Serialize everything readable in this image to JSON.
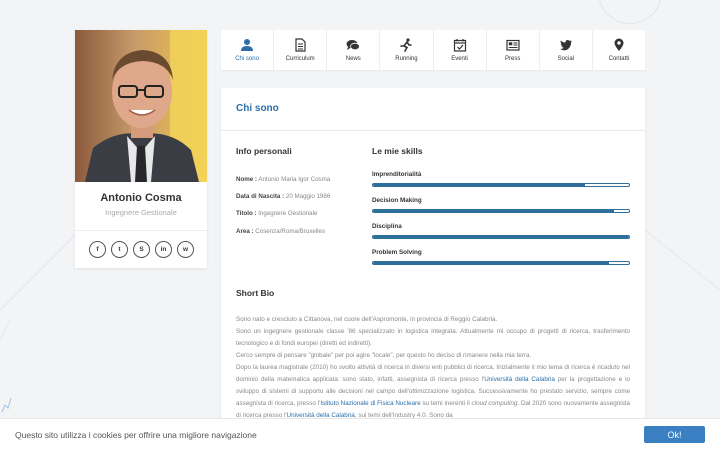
{
  "profile": {
    "name": "Antonio Cosma",
    "role": "Ingegnere Gestionale",
    "socials": [
      {
        "icon": "facebook-icon",
        "glyph": "f"
      },
      {
        "icon": "twitter-icon",
        "glyph": "t"
      },
      {
        "icon": "skype-icon",
        "glyph": "S"
      },
      {
        "icon": "linkedin-icon",
        "glyph": "in"
      },
      {
        "icon": "whatsapp-icon",
        "glyph": "w"
      }
    ]
  },
  "nav": {
    "items": [
      {
        "label": "Chi sono",
        "icon": "user-icon",
        "active": true
      },
      {
        "label": "Curriculum",
        "icon": "document-icon",
        "active": false
      },
      {
        "label": "News",
        "icon": "comments-icon",
        "active": false
      },
      {
        "label": "Running",
        "icon": "running-icon",
        "active": false
      },
      {
        "label": "Eventi",
        "icon": "calendar-icon",
        "active": false
      },
      {
        "label": "Press",
        "icon": "newspaper-icon",
        "active": false
      },
      {
        "label": "Social",
        "icon": "twitter-icon",
        "active": false
      },
      {
        "label": "Contatti",
        "icon": "map-marker-icon",
        "active": false
      }
    ]
  },
  "main": {
    "title": "Chi sono",
    "info": {
      "title": "Info personali",
      "rows": [
        {
          "label": "Nome :",
          "value": "Antonio Maria Igor Cosma"
        },
        {
          "label": "Data di Nascita :",
          "value": "20 Maggio 1986"
        },
        {
          "label": "Titolo :",
          "value": "Ingegnere Gestionale"
        },
        {
          "label": "Area :",
          "value": "Cosenza/Roma/Bruxelles"
        }
      ]
    },
    "skills": {
      "title": "Le mie skills",
      "items": [
        {
          "name": "Imprenditorialità",
          "level": 0.83
        },
        {
          "name": "Decision Making",
          "level": 0.94
        },
        {
          "name": "Disciplina",
          "level": 1.0
        },
        {
          "name": "Problem Solving",
          "level": 0.92
        }
      ]
    },
    "bio": {
      "title": "Short Bio",
      "p1": "Sono nato e cresciuto a Cittanova, nel cuore dell'Aspromonte, in provincia di Reggio Calabria.",
      "p2": "Sono un ingegnere gestionale classe '86 specializzato in logistica integrata. Attualmente mi occupo di progetti di ricerca, trasferimento tecnologico e di fondi europei (diretti ed indiretti).",
      "p3": "Cerco sempre di pensare \"globale\" per poi agire \"locale\", per questo ho deciso di rimanere nella mia terra.",
      "p4_a": "Dopo la laurea magistrale (2010) ho svolto attività di ricerca in diversi enti pubblici di ricerca. Inizialmente il mio tema di ricerca è ricaduto nel dominio della matematica applicata: sono stato, infatti, assegnista di ricerca presso l'",
      "p4_link1": "Università della Calabria",
      "p4_b": " per la progettazione e lo sviluppo di sistemi di supporto alle decisioni nel campo dell'ottimizzazione logistica. Successivamente ho prestato servizio, sempre come assegnista di ricerca, presso l'",
      "p4_link2": "Istituto Nazionale di Fisica Nucleare",
      "p4_c": " su temi inerenti il ",
      "p4_em": "cloud computing",
      "p4_d": ". Dal 2020 sono nuovamente assegnista di ricerca presso l'",
      "p4_link3": "Università della Calabria",
      "p4_e": ", sui temi dell'Industry 4.0. Sono da"
    }
  },
  "cookie": {
    "text": "Questo sito utilizza i cookies per offrire una migliore navigazione",
    "button": "Ok!"
  },
  "colors": {
    "accent": "#2b6ea8",
    "skill_bar": "#2f6f9c",
    "cookie_button": "#3a7fc1"
  }
}
